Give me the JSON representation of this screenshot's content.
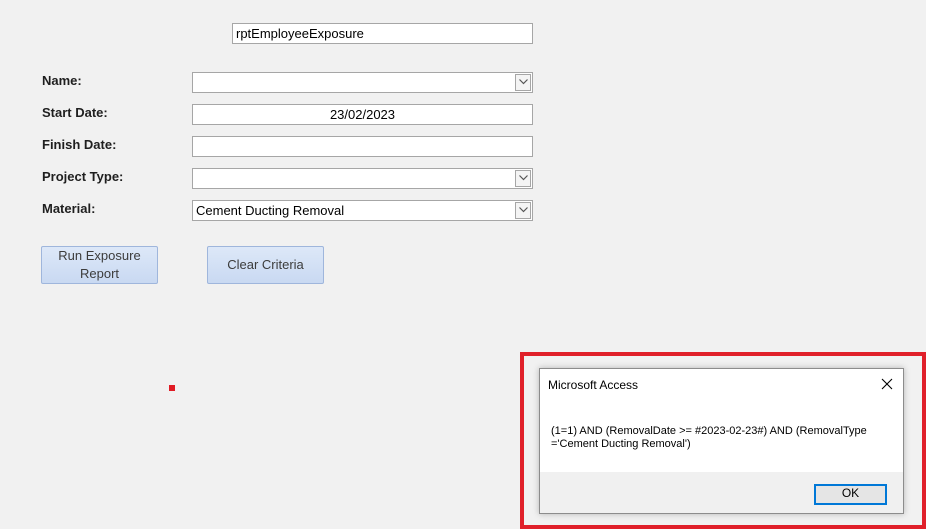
{
  "form": {
    "report_name": "rptEmployeeExposure",
    "name_label": "Name:",
    "name_value": "",
    "start_date_label": "Start Date:",
    "start_date_value": "23/02/2023",
    "finish_date_label": "Finish Date:",
    "finish_date_value": "",
    "project_type_label": "Project Type:",
    "project_type_value": "",
    "material_label": "Material:",
    "material_value": "Cement Ducting Removal",
    "run_button_line1": "Run Exposure",
    "run_button_line2": "Report",
    "clear_button": "Clear Criteria"
  },
  "dialog": {
    "title": "Microsoft Access",
    "message_line1": "(1=1) AND (RemovalDate >= #2023-02-23#) AND (RemovalType",
    "message_line2": "='Cement Ducting Removal')",
    "ok_label": "OK"
  },
  "icons": {
    "combo_arrow": "chevron-down-icon",
    "close": "close-icon"
  },
  "colors": {
    "highlight": "#e0202a",
    "button_face": "#c9d9f2",
    "ok_border": "#0078d7"
  }
}
